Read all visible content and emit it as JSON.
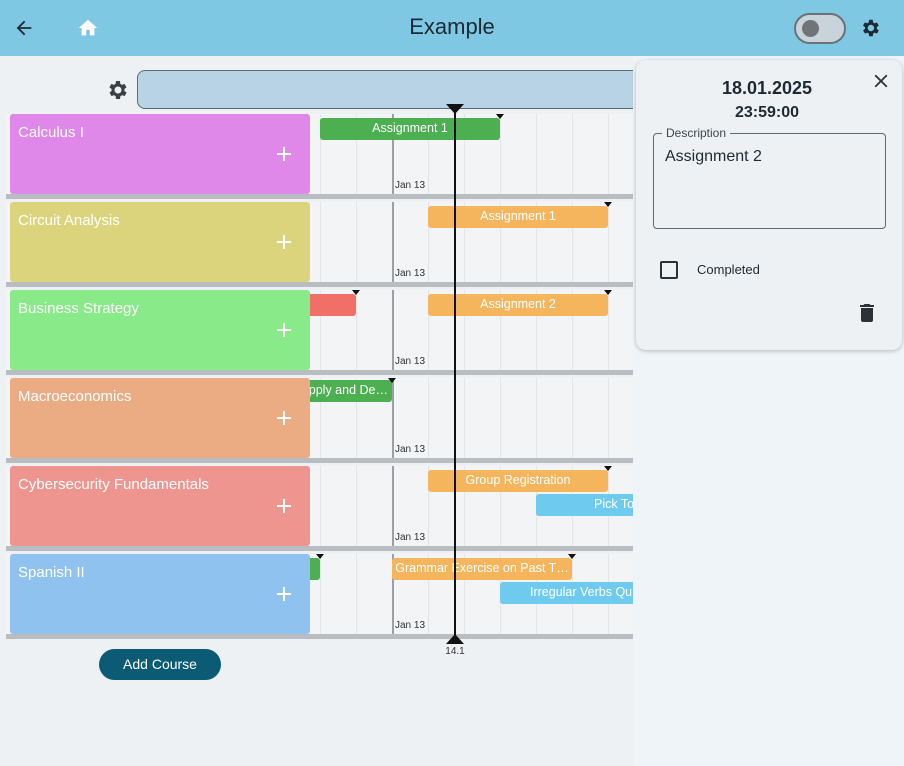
{
  "appbar": {
    "title": "Example",
    "back_icon": "arrow-back-icon",
    "home_icon": "home-icon",
    "settings_icon": "gear-icon",
    "toggle_on": false,
    "color": "#7ec8e3"
  },
  "timeline": {
    "date_label": "Jan 13",
    "now_label": "14.1",
    "add_course_label": "Add Course",
    "courses": [
      {
        "name": "Calculus I",
        "color": "#df88ea",
        "add_icon": "plus-icon"
      },
      {
        "name": "Circuit Analysis",
        "color": "#dcd47c",
        "add_icon": "plus-icon"
      },
      {
        "name": "Business Strategy",
        "color": "#88ea88",
        "add_icon": "plus-icon"
      },
      {
        "name": "Macroeconomics",
        "color": "#ebac84",
        "add_icon": "plus-icon"
      },
      {
        "name": "Cybersecurity Fundamentals",
        "color": "#ee9590",
        "add_icon": "plus-icon"
      },
      {
        "name": "Spanish II",
        "color": "#8fc2ee",
        "add_icon": "plus-icon"
      }
    ],
    "tasks": [
      {
        "label": "Assignment 1",
        "color": "green"
      },
      {
        "label": "Assignment 1",
        "color": "orange"
      },
      {
        "label": "Assignment 2",
        "color": "orange"
      },
      {
        "label": "Supply and De…",
        "color": "green"
      },
      {
        "label": "Group Registration",
        "color": "orange"
      },
      {
        "label": "Pick To…",
        "color": "blue"
      },
      {
        "label": "Grammar Exercise on Past T…",
        "color": "orange"
      },
      {
        "label": "Irregular Verbs Qu…",
        "color": "blue"
      }
    ]
  },
  "detail": {
    "date": "18.01.2025",
    "time": "23:59:00",
    "description_label": "Description",
    "description_value": "Assignment 2",
    "completed_label": "Completed",
    "completed": false,
    "close_icon": "close-icon",
    "delete_icon": "trash-icon"
  }
}
